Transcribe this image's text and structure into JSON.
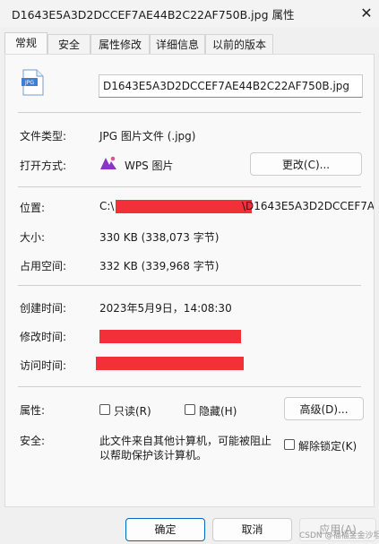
{
  "window": {
    "title": "D1643E5A3D2DCCEF7AE44B2C22AF750B.jpg 属性",
    "close_symbol": "✕"
  },
  "tabs": [
    {
      "label": "常规",
      "active": true
    },
    {
      "label": "安全"
    },
    {
      "label": "属性修改"
    },
    {
      "label": "详细信息"
    },
    {
      "label": "以前的版本"
    }
  ],
  "file": {
    "icon_name": "jpg-file-icon",
    "icon_text": "JPG",
    "name": "D1643E5A3D2DCCEF7AE44B2C22AF750B.jpg"
  },
  "type_row": {
    "label": "文件类型:",
    "value": "JPG 图片文件 (.jpg)"
  },
  "open_row": {
    "label": "打开方式:",
    "app": "WPS 图片",
    "change_button": "更改(C)..."
  },
  "location_row": {
    "label": "位置:",
    "prefix": "C:\\",
    "suffix": "\\D1643E5A3D2DCCEF7A"
  },
  "size_row": {
    "label": "大小:",
    "value": "330 KB (338,073 字节)"
  },
  "disk_row": {
    "label": "占用空间:",
    "value": "332 KB (339,968 字节)"
  },
  "created_row": {
    "label": "创建时间:",
    "value": "2023年5月9日，14:08:30"
  },
  "modified_row": {
    "label": "修改时间:"
  },
  "accessed_row": {
    "label": "访问时间:"
  },
  "attributes": {
    "label": "属性:",
    "readonly_label": "只读(R)",
    "hidden_label": "隐藏(H)",
    "advanced_button": "高级(D)..."
  },
  "security": {
    "label": "安全:",
    "line1": "此文件来自其他计算机，可能被阻止",
    "line2": "以帮助保护该计算机。",
    "unblock_label": "解除锁定(K)"
  },
  "footer": {
    "ok": "确定",
    "cancel": "取消",
    "apply": "应用(A)"
  },
  "watermark": "CSDN @福福金金沙坦",
  "colors": {
    "redaction": "#f3303a",
    "accent": "#0067c0",
    "wps_logo": "#8a35c9"
  }
}
